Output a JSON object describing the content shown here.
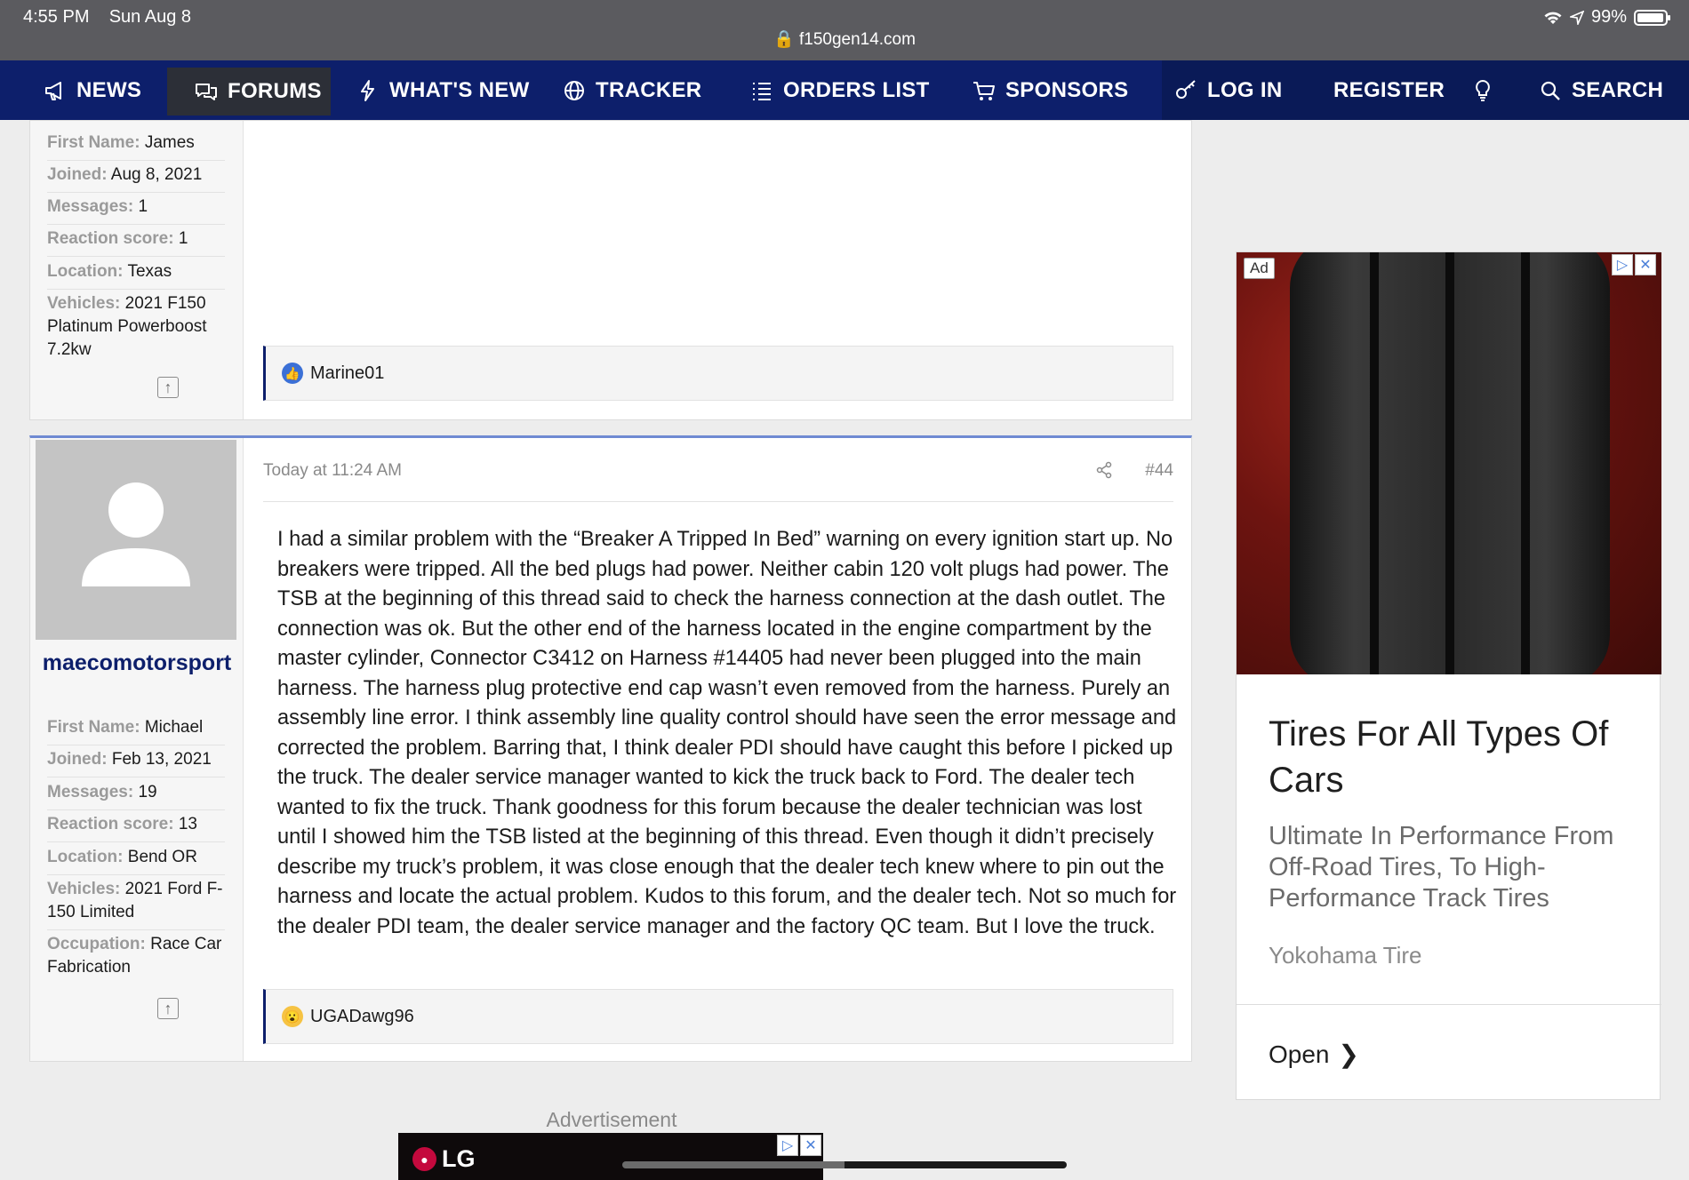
{
  "status_bar": {
    "time": "4:55 PM",
    "date": "Sun Aug 8",
    "url": "f150gen14.com",
    "battery": "99%"
  },
  "nav": {
    "items": [
      {
        "label": "NEWS",
        "icon": "megaphone-icon"
      },
      {
        "label": "FORUMS",
        "icon": "chat-bubbles-icon"
      },
      {
        "label": "WHAT'S NEW",
        "icon": "lightning-icon"
      },
      {
        "label": "TRACKER",
        "icon": "globe-icon"
      },
      {
        "label": "ORDERS LIST",
        "icon": "list-icon"
      },
      {
        "label": "SPONSORS",
        "icon": "cart-icon"
      }
    ],
    "login": "LOG IN",
    "register": "REGISTER",
    "search": "SEARCH",
    "colors": {
      "nav_bg": "#0d1f6b",
      "active_bg": "#2c2f37"
    }
  },
  "posts": [
    {
      "user_props": [
        {
          "key": "First Name:",
          "value": "James"
        },
        {
          "key": "Joined:",
          "value": "Aug 8, 2021"
        },
        {
          "key": "Messages:",
          "value": "1"
        },
        {
          "key": "Reaction score:",
          "value": "1"
        },
        {
          "key": "Location:",
          "value": "Texas"
        },
        {
          "key": "Vehicles:",
          "value": "2021 F150 Platinum Powerboost 7.2kw"
        }
      ],
      "reaction_user": "Marine01",
      "reaction_icon": "thumbs-up-icon"
    },
    {
      "username": "maecomotorsport",
      "date": "Today at 11:24 AM",
      "post_number": "#44",
      "user_props": [
        {
          "key": "First Name:",
          "value": "Michael"
        },
        {
          "key": "Joined:",
          "value": "Feb 13, 2021"
        },
        {
          "key": "Messages:",
          "value": "19"
        },
        {
          "key": "Reaction score:",
          "value": "13"
        },
        {
          "key": "Location:",
          "value": "Bend OR"
        },
        {
          "key": "Vehicles:",
          "value": "2021 Ford F-150 Limited"
        },
        {
          "key": "Occupation:",
          "value": "Race Car Fabrication"
        }
      ],
      "body": "I had a similar problem with the “Breaker A Tripped In Bed” warning on every ignition start up. No breakers were tripped. All the bed plugs had power. Neither cabin 120 volt plugs had power. The TSB at the beginning of this thread said to check the harness connection at the dash outlet. The connection was ok. But the other end of the harness located in the engine compartment by the master cylinder, Connector C3412 on Harness #14405 had never been plugged into the main harness. The harness plug protective end cap wasn’t even removed from the harness. Purely an assembly line error. I think assembly line quality control should have seen the error message and corrected the problem. Barring that, I think dealer PDI should have caught this before I picked up the truck. The dealer service manager wanted to kick the truck back to Ford. The dealer tech wanted to fix the truck. Thank goodness for this forum because the dealer technician was lost until I showed him the TSB listed at the beginning of this thread. Even though it didn’t precisely describe my truck’s problem, it was close enough that the dealer tech knew where to pin out the harness and locate the actual problem. Kudos to this forum, and the dealer tech. Not so much for the dealer PDI team, the dealer service manager and the factory QC team. But I love the truck.",
      "reaction_user": "UGADawg96",
      "reaction_icon": "wow-face-icon"
    }
  ],
  "ad_right": {
    "badge": "Ad",
    "title": "Tires For All Types Of Cars",
    "description": "Ultimate In Performance From Off-Road Tires, To High-Performance Track Tires",
    "brand": "Yokohama Tire",
    "cta": "Open"
  },
  "ad_bottom": {
    "label": "Advertisement",
    "logo_text": "LG"
  }
}
